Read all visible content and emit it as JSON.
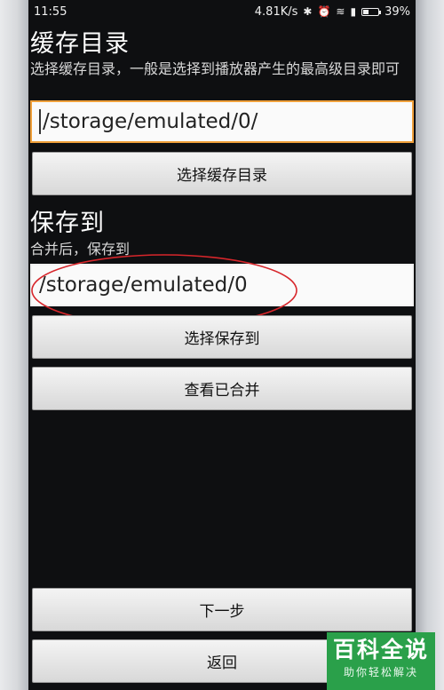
{
  "status_bar": {
    "time": "11:55",
    "net_speed": "4.81K/s",
    "battery_percent": "39%",
    "battery_level": 0.39
  },
  "cache_section": {
    "title": "缓存目录",
    "description": "选择缓存目录，一般是选择到播放器产生的最高级目录即可",
    "path_value": "/storage/emulated/0/",
    "select_button": "选择缓存目录"
  },
  "save_section": {
    "title": "保存到",
    "description": "合并后，保存到",
    "path_value": "/storage/emulated/0",
    "select_button": "选择保存到",
    "view_merged_button": "查看已合并"
  },
  "bottom": {
    "next_button": "下一步",
    "back_button": "返回"
  },
  "watermark": {
    "main": "百科全说",
    "sub": "助你轻松解决"
  },
  "colors": {
    "focus_border": "#f0a03a",
    "annotation_red": "#d7262b",
    "watermark_green": "#2aa04a"
  }
}
